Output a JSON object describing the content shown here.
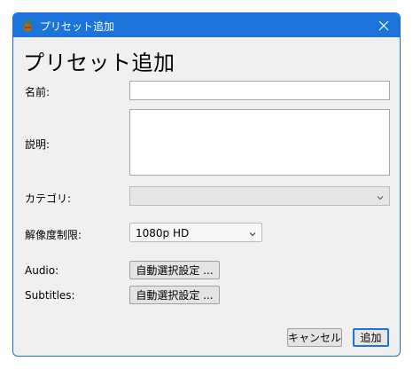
{
  "window": {
    "title": "プリセット追加",
    "heading": "プリセット追加"
  },
  "form": {
    "name_label": "名前:",
    "name_value": "",
    "description_label": "説明:",
    "description_value": "",
    "category_label": "カテゴリ:",
    "category_value": "",
    "resolution_label": "解像度制限:",
    "resolution_value": "1080p HD",
    "audio_label": "Audio:",
    "audio_button": "自動選択設定 ...",
    "subtitles_label": "Subtitles:",
    "subtitles_button": "自動選択設定 ..."
  },
  "footer": {
    "cancel_label": "キャンセル",
    "add_label": "追加"
  },
  "colors": {
    "titlebar": "#1c73d9",
    "dialog_bg": "#f0f0f0",
    "accent_border": "#1c73d9"
  },
  "icons": {
    "app": "handbrake-pineapple-icon",
    "close": "close-icon",
    "chevron": "chevron-down-icon"
  }
}
